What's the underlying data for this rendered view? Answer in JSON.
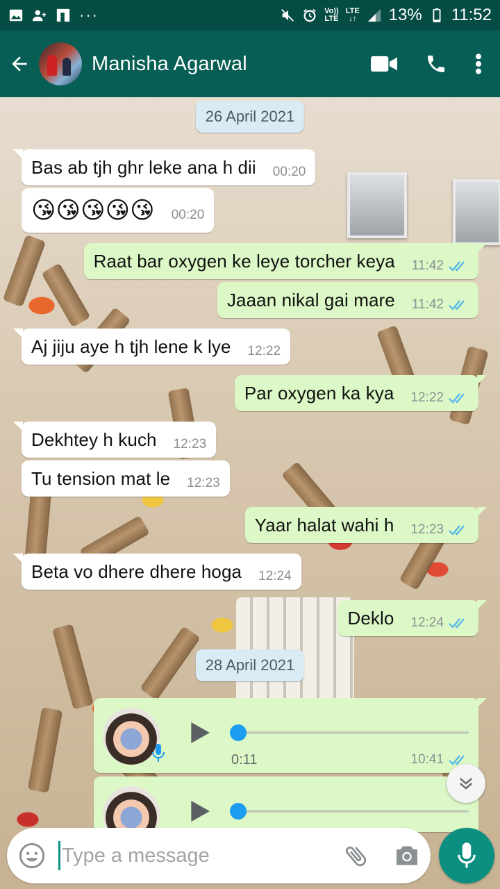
{
  "status_bar": {
    "battery": "13%",
    "time": "11:52",
    "network_top": "Vo))",
    "network_bottom": "LTE",
    "lte": "LTE",
    "dots": "···"
  },
  "header": {
    "contact_name": "Manisha Agarwal",
    "icons": [
      "back-arrow-icon",
      "video-call-icon",
      "voice-call-icon",
      "more-options-icon"
    ]
  },
  "chat": {
    "date_1": "26 April 2021",
    "date_2": "28 April 2021",
    "messages": [
      {
        "direction": "in",
        "text": "Bas ab tjh ghr leke ana h dii",
        "time": "00:20"
      },
      {
        "direction": "in",
        "text": "😘😘😘😘😘",
        "time": "00:20"
      },
      {
        "direction": "out",
        "text": "Raat bar oxygen ke leye torcher keya",
        "time": "11:42",
        "status": "read"
      },
      {
        "direction": "out",
        "text": "Jaaan nikal gai mare",
        "time": "11:42",
        "status": "read"
      },
      {
        "direction": "in",
        "text": "Aj jiju aye h tjh lene k lye",
        "time": "12:22"
      },
      {
        "direction": "out",
        "text": "Par oxygen ka kya",
        "time": "12:22",
        "status": "read"
      },
      {
        "direction": "in",
        "text": "Dekhtey h kuch",
        "time": "12:23"
      },
      {
        "direction": "in",
        "text": "Tu tension mat le",
        "time": "12:23"
      },
      {
        "direction": "out",
        "text": "Yaar halat wahi h",
        "time": "12:23",
        "status": "read"
      },
      {
        "direction": "in",
        "text": "Beta vo dhere dhere hoga",
        "time": "12:24"
      },
      {
        "direction": "out",
        "text": "Deklo",
        "time": "12:24",
        "status": "read"
      }
    ],
    "voice_messages": [
      {
        "duration": "0:11",
        "time": "10:41",
        "status": "read",
        "progress": 0
      },
      {
        "duration": "",
        "time": "",
        "status": "",
        "progress": 0
      }
    ]
  },
  "composer": {
    "placeholder": "Type a message",
    "icons": [
      "emoji-icon",
      "attach-icon",
      "camera-icon",
      "mic-icon"
    ]
  },
  "colors": {
    "header": "#075e54",
    "status_bar": "#054d44",
    "outgoing_bubble": "#dcf8c6",
    "incoming_bubble": "#ffffff",
    "read_ticks": "#4fb6ec",
    "mic_button": "#0a8f80"
  }
}
